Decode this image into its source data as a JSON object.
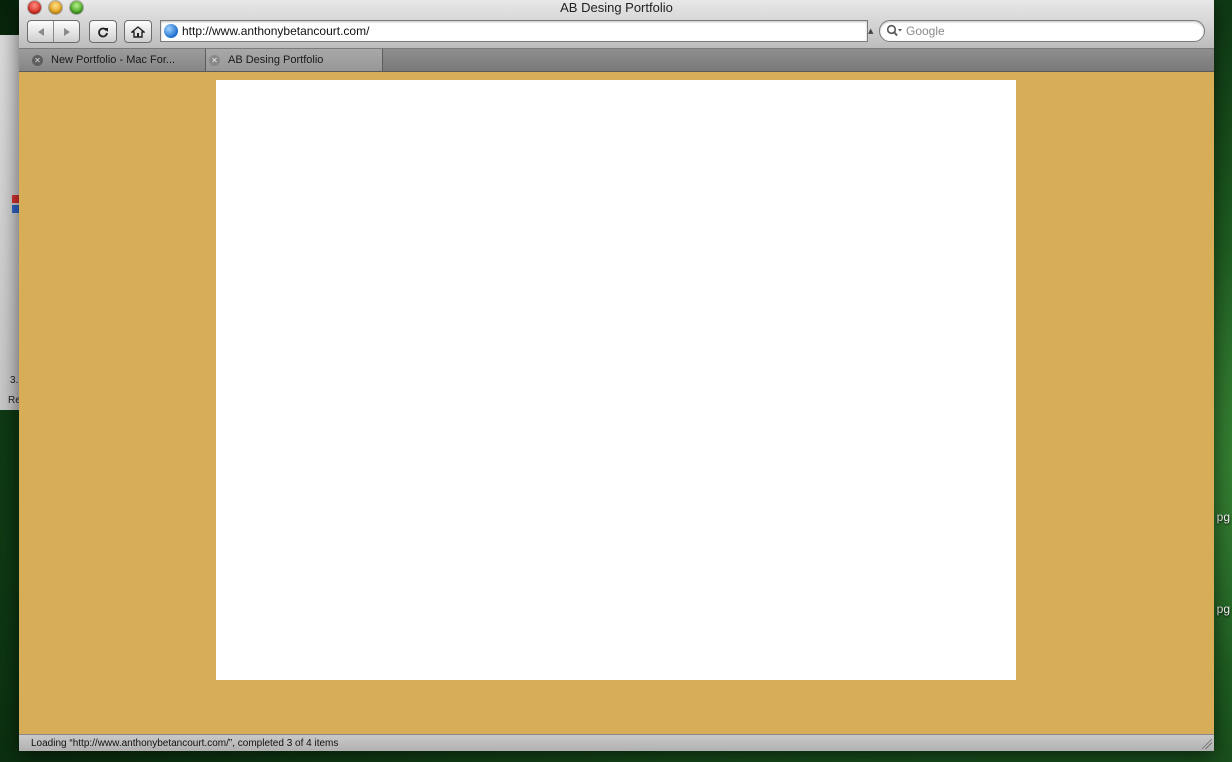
{
  "window": {
    "title": "AB Desing Portfolio"
  },
  "toolbar": {
    "back_icon": "back-arrow",
    "forward_icon": "forward-arrow",
    "reload_icon": "reload",
    "home_icon": "home",
    "url": "http://www.anthonybetancourt.com/",
    "search_placeholder": "Google"
  },
  "tabs": [
    {
      "label": "New Portfolio - Mac For...",
      "active": false
    },
    {
      "label": "AB Desing Portfolio",
      "active": true
    }
  ],
  "page": {
    "background_color": "#d7ad57",
    "panel_color": "#ffffff"
  },
  "status": {
    "text": "Loading “http://www.anthonybetancourt.com/”, completed 3 of 4 items"
  },
  "background": {
    "left_fragment_1": "3.",
    "left_fragment_2": "Re",
    "desktop_fragment_1": "pg",
    "desktop_fragment_2": "pg"
  }
}
